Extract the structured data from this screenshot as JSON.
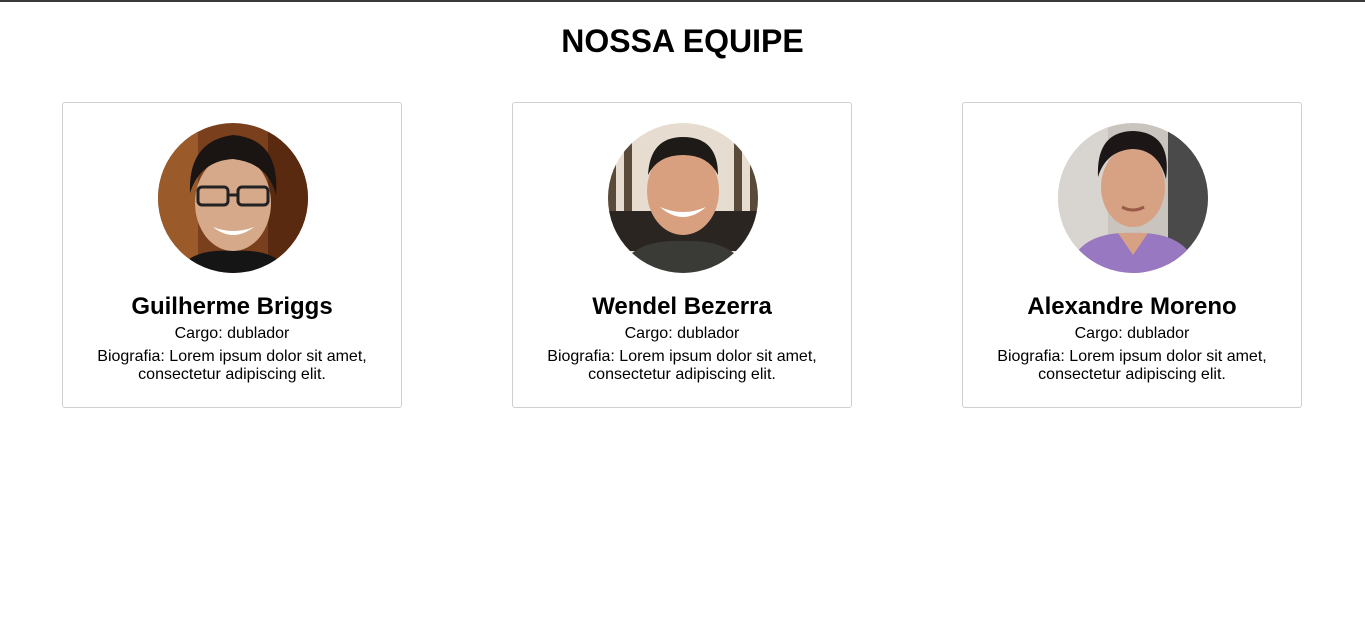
{
  "page": {
    "title": "NOSSA EQUIPE"
  },
  "team": [
    {
      "name": "Guilherme Briggs",
      "role": "Cargo: dublador",
      "bio": "Biografia: Lorem ipsum dolor sit amet, consectetur adipiscing elit."
    },
    {
      "name": "Wendel Bezerra",
      "role": "Cargo: dublador",
      "bio": "Biografia: Lorem ipsum dolor sit amet, consectetur adipiscing elit."
    },
    {
      "name": "Alexandre Moreno",
      "role": "Cargo: dublador",
      "bio": "Biografia: Lorem ipsum dolor sit amet, consectetur adipiscing elit."
    }
  ]
}
